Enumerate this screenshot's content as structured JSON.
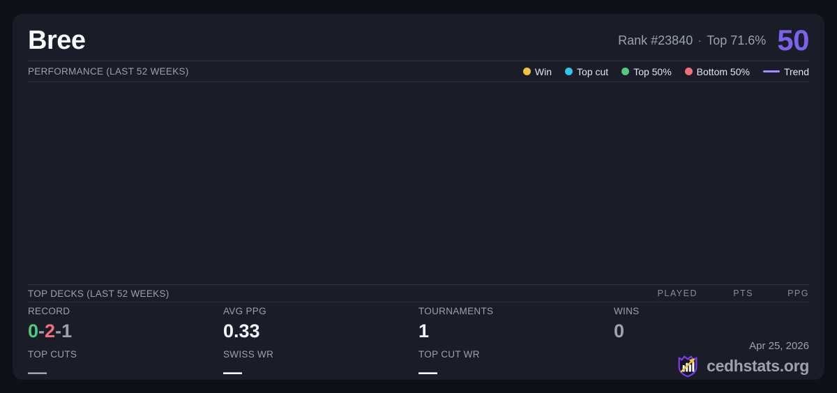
{
  "colors": {
    "accent": "#7c62ea",
    "positive": "#4ec97d",
    "negative": "#f2707a",
    "neutral": "#9ca3af",
    "value_white": "#f5f6f8"
  },
  "header": {
    "title": "Bree",
    "rank": "Rank #23840",
    "separator": "·",
    "top_percent": "Top 71.6%",
    "score": "50"
  },
  "performance": {
    "title": "PERFORMANCE (LAST 52 WEEKS)",
    "legend": [
      {
        "label": "Win",
        "color": "#f0c33c"
      },
      {
        "label": "Top cut",
        "color": "#2cc7e8"
      },
      {
        "label": "Top 50%",
        "color": "#4ec97d"
      },
      {
        "label": "Bottom 50%",
        "color": "#f2707a"
      },
      {
        "label": "Trend",
        "color": "#a78bfa"
      }
    ],
    "data_points": []
  },
  "top_decks": {
    "title": "TOP DECKS (LAST 52 WEEKS)",
    "columns": [
      "PLAYED",
      "PTS",
      "PPG"
    ],
    "rows": []
  },
  "stats": {
    "record": {
      "label": "RECORD",
      "wins": "0",
      "losses": "2",
      "draws": "1",
      "sep": "-"
    },
    "avg_ppg": {
      "label": "AVG PPG",
      "value": "0.33"
    },
    "tournaments": {
      "label": "TOURNAMENTS",
      "value": "1"
    },
    "wins": {
      "label": "WINS",
      "value": "0"
    },
    "top_cuts": {
      "label": "TOP CUTS",
      "value": "—"
    },
    "swiss_wr": {
      "label": "SWISS WR",
      "value": "—"
    },
    "top_cut_wr": {
      "label": "TOP CUT WR",
      "value": "—"
    }
  },
  "footer": {
    "date": "Apr 25, 2026",
    "brand": "cedhstats.org"
  }
}
